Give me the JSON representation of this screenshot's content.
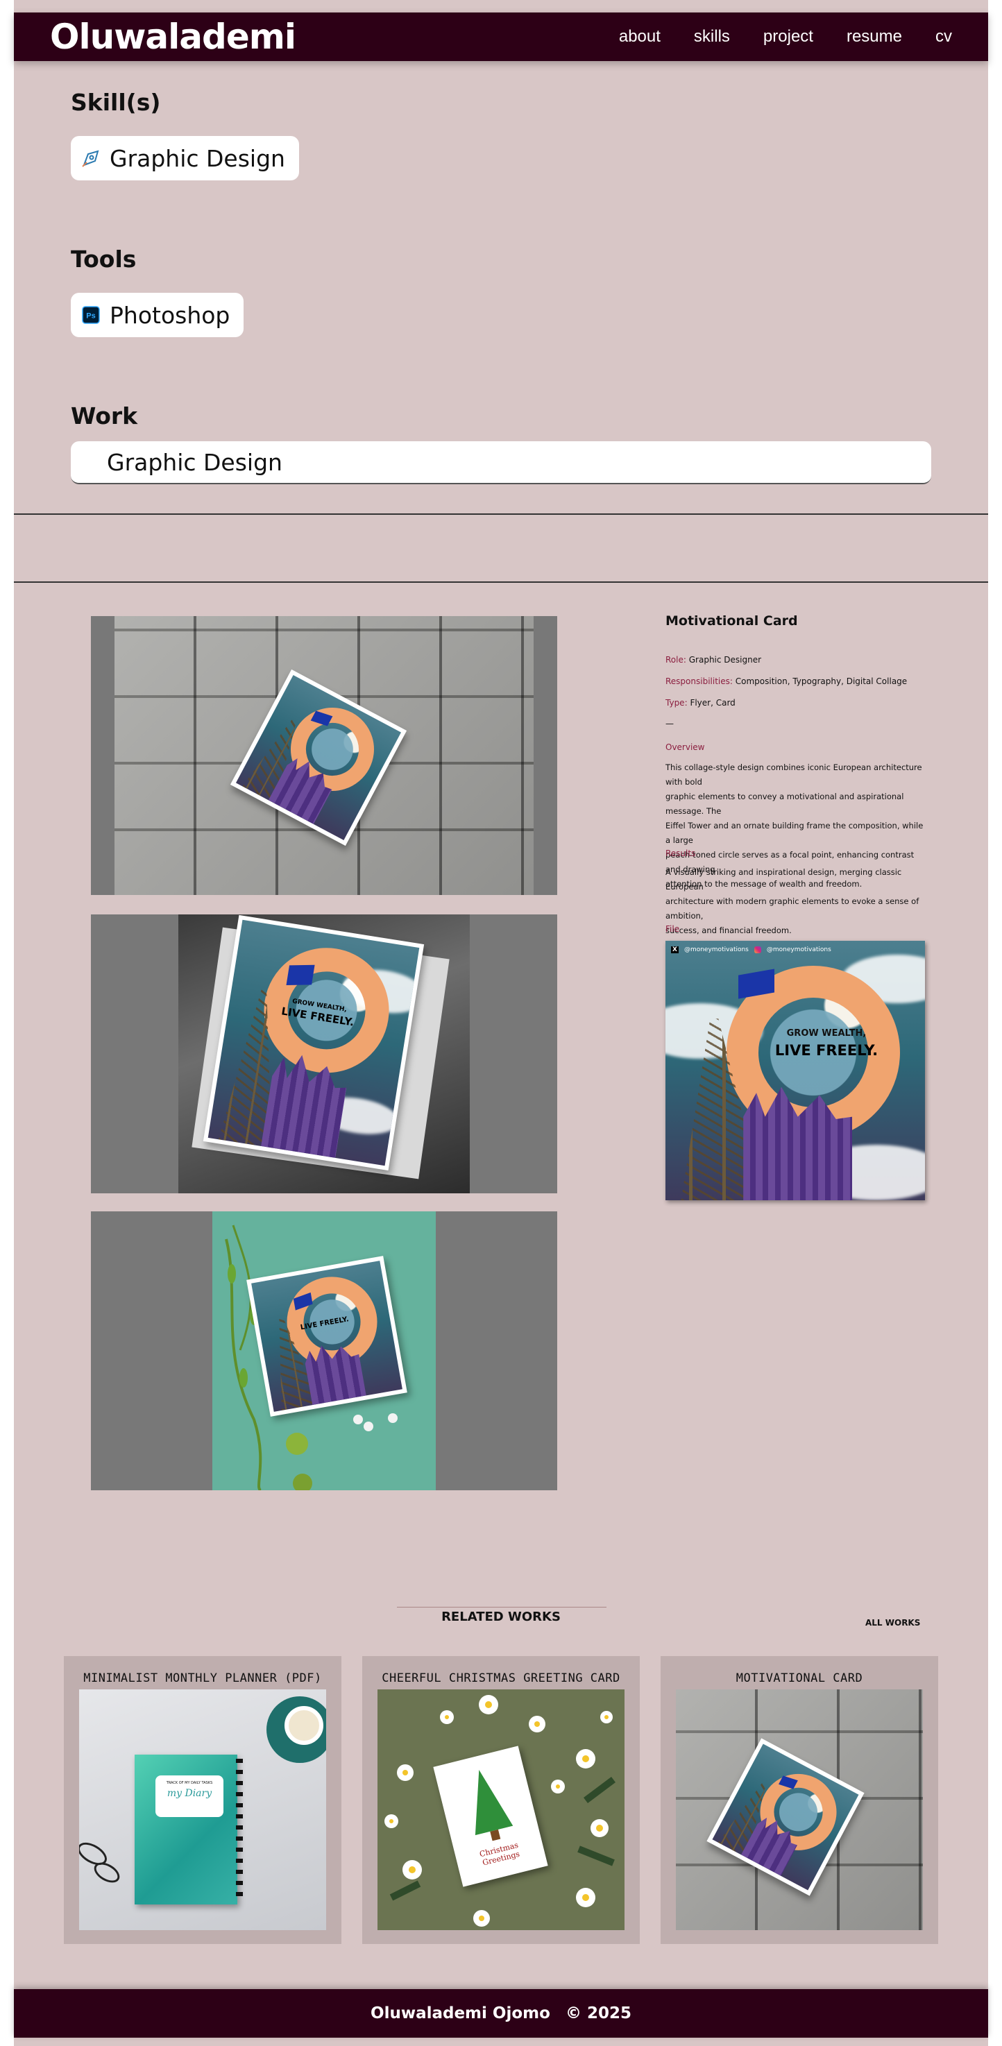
{
  "nav": {
    "brand": "Oluwalademi",
    "links": [
      "about",
      "skills",
      "project",
      "resume",
      "cv"
    ]
  },
  "skills": {
    "heading": "Skill(s)",
    "items": [
      {
        "label": "Graphic Design",
        "icon": "pen-tool-icon"
      }
    ]
  },
  "tools": {
    "heading": "Tools",
    "items": [
      {
        "label": "Photoshop",
        "icon": "photoshop-icon"
      }
    ]
  },
  "work": {
    "heading": "Work",
    "selected": "Graphic Design"
  },
  "project": {
    "title": "Motivational Card",
    "role_key": "Role:",
    "role": "Graphic Designer",
    "resp_key": "Responsibilities:",
    "responsibilities": "Composition, Typography, Digital Collage",
    "type_key": "Type:",
    "type": "Flyer, Card",
    "separator": "—",
    "overview_heading": "Overview",
    "overview_lines": [
      "This collage-style design combines iconic European architecture with bold",
      "graphic elements to convey a motivational and aspirational message. The",
      "Eiffel Tower and an ornate building frame the composition, while a large",
      "peach-toned circle serves as a focal point, enhancing contrast and drawing",
      "attention to the message of wealth and freedom."
    ],
    "results_heading": "Results",
    "results_lines": [
      "A visually striking and inspirational design, merging classic European",
      "architecture with modern graphic elements to evoke a sense of ambition,",
      "success, and financial freedom."
    ],
    "file_heading": "File",
    "artwork": {
      "handle_x": "@moneymotivations",
      "handle_ig": "@moneymotivations",
      "line1": "GROW WEALTH,",
      "line2": "LIVE FREELY."
    }
  },
  "related": {
    "heading": "RELATED WORKS",
    "all_link": "ALL WORKS",
    "cards": [
      {
        "title": "MINIMALIST MONTHLY PLANNER (PDF)",
        "diary_top": "TRACK OF MY DAILY TASKS",
        "diary_title": "my Diary"
      },
      {
        "title": "CHEERFUL CHRISTMAS GREETING CARD",
        "greeting1": "Christmas",
        "greeting2": "Greetings"
      },
      {
        "title": "MOTIVATIONAL CARD"
      }
    ]
  },
  "footer": {
    "name": "Oluwalademi Ojomo",
    "copyright": "© 2025"
  },
  "colors": {
    "nav_bg": "#2d0016",
    "page_bg": "#d8c6c6",
    "accent_label": "#8b1e3f",
    "card_bg": "#bfaeae"
  }
}
